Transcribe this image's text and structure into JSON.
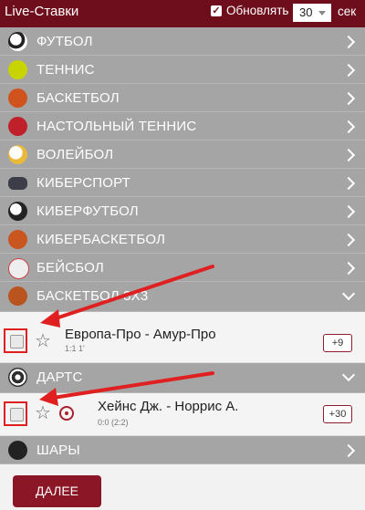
{
  "header": {
    "title_live": "Live",
    "title_rest": "-Ставки",
    "refresh_label": "Обновлять",
    "refresh_checked_glyph": "✓",
    "interval_value": "30",
    "interval_unit": "сек"
  },
  "sports": [
    {
      "label": "ФУТБОЛ",
      "icon": "soccer-ball-icon",
      "color": "#2b2b2b"
    },
    {
      "label": "ТЕННИС",
      "icon": "tennis-ball-icon",
      "color": "#c8d400"
    },
    {
      "label": "БАСКЕТБОЛ",
      "icon": "basketball-icon",
      "color": "#d0531d"
    },
    {
      "label": "НАСТОЛЬНЫЙ ТЕННИС",
      "icon": "table-tennis-icon",
      "color": "#c0202a"
    },
    {
      "label": "ВОЛЕЙБОЛ",
      "icon": "volleyball-icon",
      "color": "#e8b93a"
    },
    {
      "label": "КИБЕРСПОРТ",
      "icon": "gamepad-icon",
      "color": "#3d3d4a"
    },
    {
      "label": "КИБЕРФУТБОЛ",
      "icon": "cyber-football-icon",
      "color": "#2a2a2a"
    },
    {
      "label": "КИБЕРБАСКЕТБОЛ",
      "icon": "cyber-basketball-icon",
      "color": "#c9561e"
    },
    {
      "label": "БЕЙСБОЛ",
      "icon": "baseball-icon",
      "color": "#eeeeee"
    },
    {
      "label": "БАСКЕТБОЛ 3Х3",
      "icon": "basketball-3x3-icon",
      "color": "#b9541f"
    },
    {
      "label": "ДАРТС",
      "icon": "darts-icon",
      "color": "#2e2e2e"
    },
    {
      "label": "ШАРЫ",
      "icon": "balls-icon",
      "color": "#222222"
    }
  ],
  "matches": [
    {
      "name": "Европа-Про - Амур-Про",
      "score": "1:1 1'",
      "more": "+9"
    },
    {
      "name": "Хейнс Дж. - Норрис А.",
      "score": "0:0 (2:2)",
      "more": "+30"
    }
  ],
  "star_glyph": "☆",
  "footer": {
    "next_label": "ДАЛЕЕ"
  },
  "colors": {
    "accent": "#6e0d1c",
    "button": "#8b1626",
    "row_bg": "#a5a5a5",
    "annotation_red": "#e02020"
  }
}
